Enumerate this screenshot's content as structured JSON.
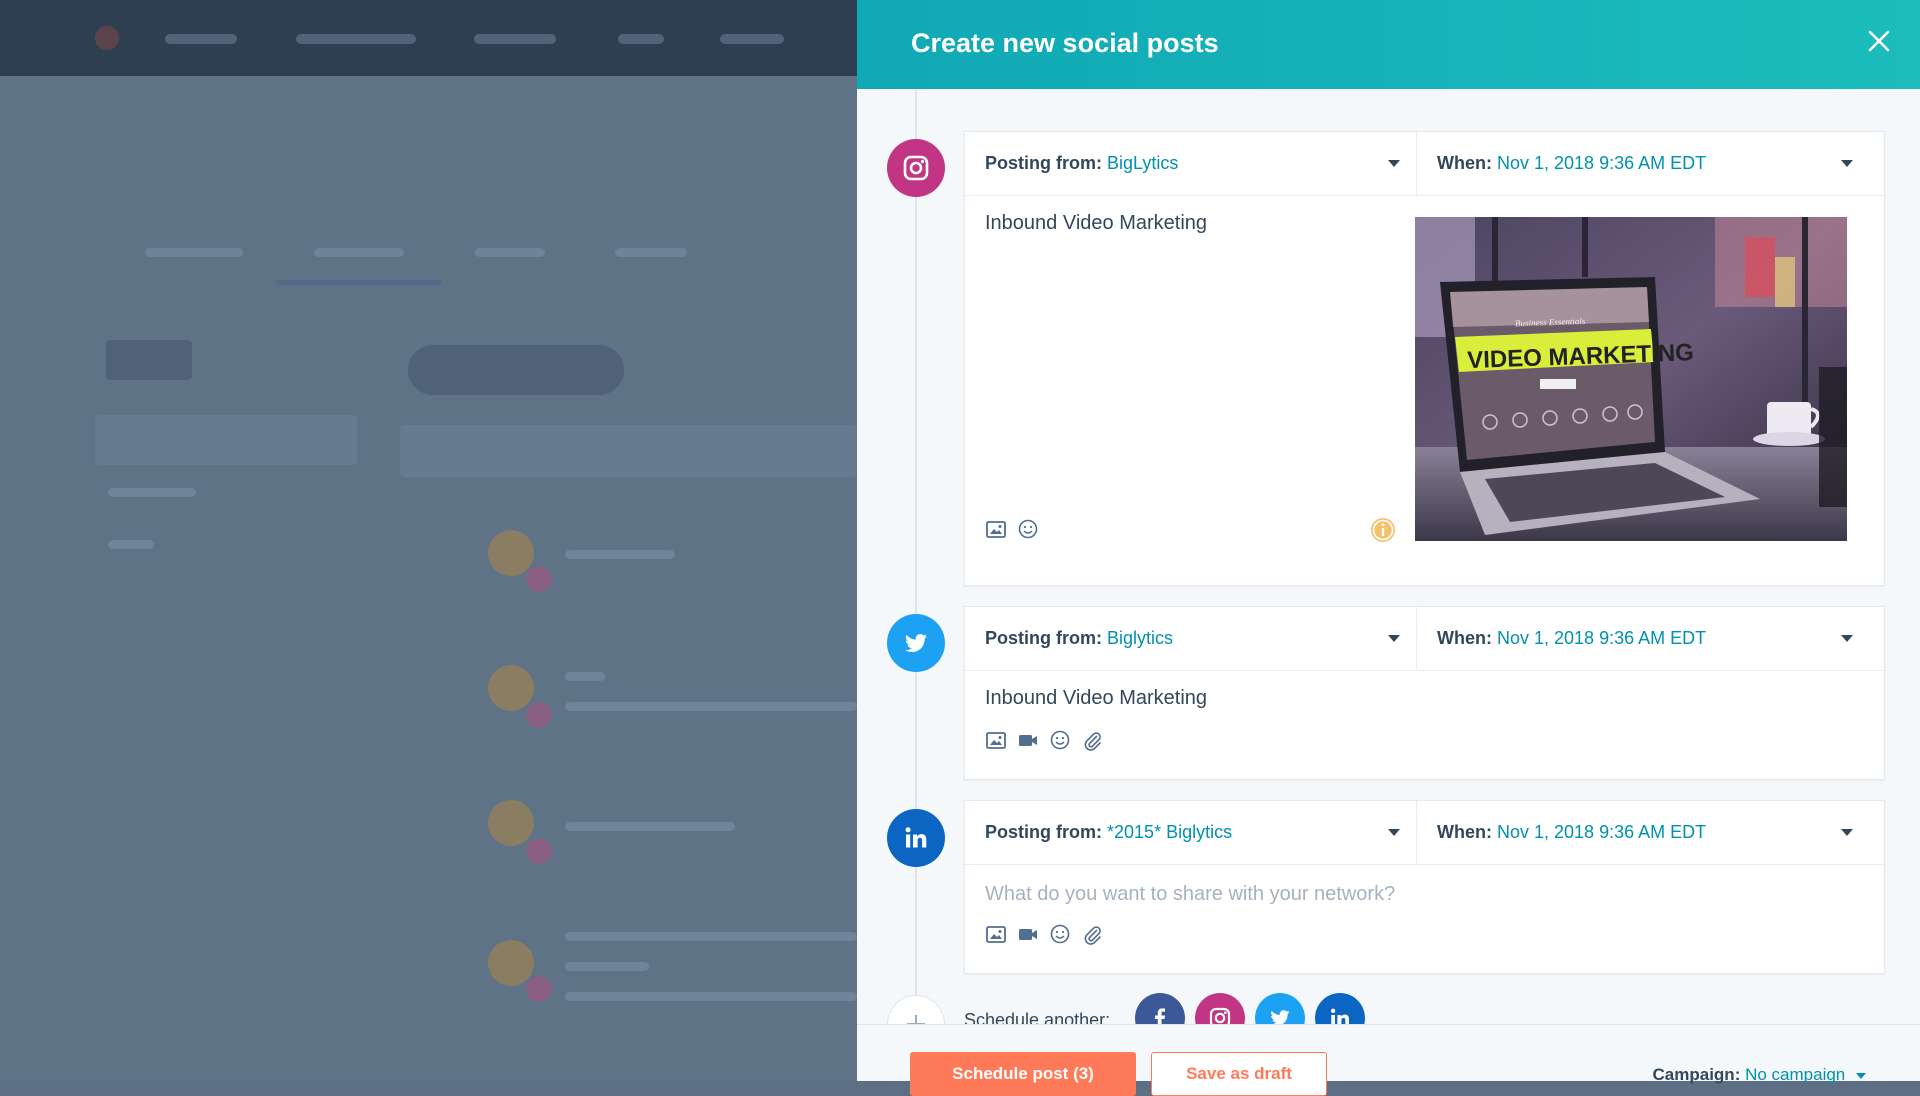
{
  "panel": {
    "title": "Create new social posts"
  },
  "posts": [
    {
      "network": "instagram",
      "posting_from_label": "Posting from:",
      "posting_from_value": "BigLytics",
      "when_label": "When:",
      "when_value": "Nov 1, 2018 9:36 AM EDT",
      "text": "Inbound Video Marketing",
      "image_screen_text": "VIDEO MARKETING",
      "image_screen_subtext": "Business Essentials"
    },
    {
      "network": "twitter",
      "posting_from_label": "Posting from:",
      "posting_from_value": "Biglytics",
      "when_label": "When:",
      "when_value": "Nov 1, 2018 9:36 AM EDT",
      "text": "Inbound Video Marketing"
    },
    {
      "network": "linkedin",
      "posting_from_label": "Posting from:",
      "posting_from_value": "*2015* Biglytics",
      "when_label": "When:",
      "when_value": "Nov 1, 2018 9:36 AM EDT",
      "placeholder": "What do you want to share with your network?"
    }
  ],
  "schedule_another": {
    "label": "Schedule another:"
  },
  "footer": {
    "schedule_button": "Schedule post (3)",
    "draft_button": "Save as draft",
    "campaign_label": "Campaign:",
    "campaign_value": "No campaign"
  },
  "colors": {
    "instagram": "#c13584",
    "twitter": "#1da1f2",
    "linkedin": "#0a66c2",
    "facebook": "#3b5998",
    "accent": "#0091ae",
    "primary_button": "#ff7a59"
  }
}
